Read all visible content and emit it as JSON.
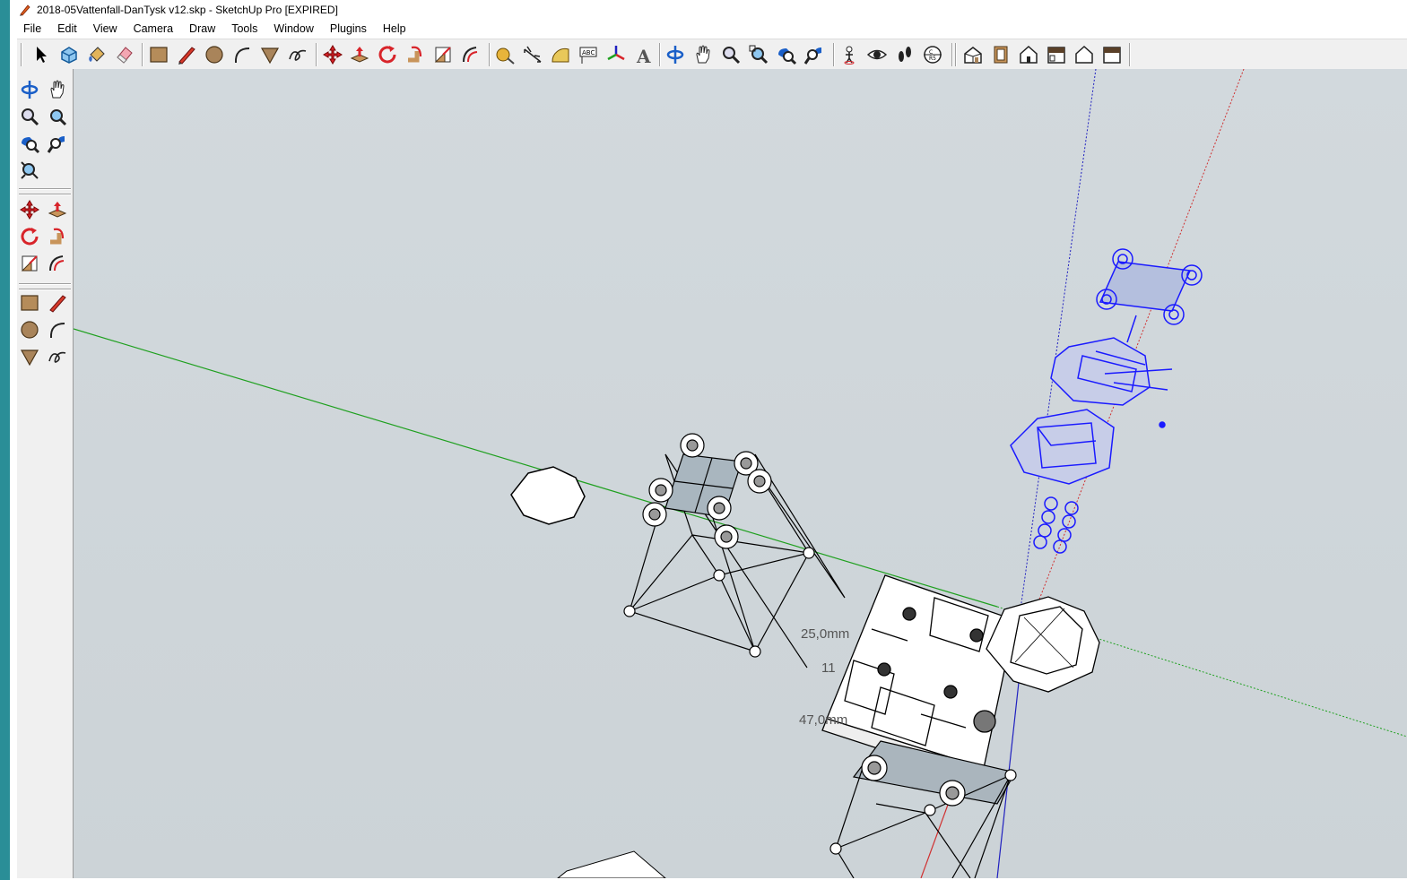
{
  "window": {
    "title": "2018-05Vattenfall-DanTysk v12.skp - SketchUp Pro [EXPIRED]"
  },
  "menu": [
    "File",
    "Edit",
    "View",
    "Camera",
    "Draw",
    "Tools",
    "Window",
    "Plugins",
    "Help"
  ],
  "top_toolbar": {
    "tools": [
      "select-icon",
      "make-component-icon",
      "paint-bucket-icon",
      "eraser-icon",
      "rectangle-icon",
      "line-icon",
      "circle-icon",
      "arc-icon",
      "polygon-icon",
      "freehand-icon",
      "move-icon",
      "push-pull-icon",
      "rotate-icon",
      "follow-me-icon",
      "scale-icon",
      "offset-icon",
      "tape-measure-icon",
      "dimension-icon",
      "protractor-icon",
      "text-icon",
      "axes-icon",
      "3d-text-icon",
      "orbit-icon",
      "pan-icon",
      "zoom-icon",
      "zoom-window-icon",
      "zoom-extents-icon",
      "previous-view-icon",
      "position-camera-icon",
      "look-around-icon",
      "walk-icon",
      "section-plane-icon",
      "iso-view-icon",
      "top-view-icon",
      "front-view-icon",
      "right-view-icon",
      "back-view-icon",
      "left-view-icon"
    ]
  },
  "left_toolbar": {
    "tools": [
      "orbit-icon",
      "pan-icon",
      "zoom-icon",
      "zoom-window-icon",
      "zoom-extents-icon",
      "previous-view-icon",
      "zoom-to-fit-icon",
      "move-icon",
      "push-pull-icon",
      "rotate-icon",
      "follow-me-icon",
      "scale-icon",
      "offset-icon",
      "rectangle-icon",
      "line-icon",
      "circle-icon",
      "arc-icon",
      "polygon-icon",
      "freehand-icon"
    ]
  },
  "viewport": {
    "dimension_labels": [
      "25,0mm",
      "11",
      "47,0mm"
    ],
    "colors": {
      "background": "#cfd6da",
      "selection": "#1a1aff",
      "green_axis": "#1fa01f",
      "red_axis": "#d03030",
      "blue_axis": "#2020c0"
    }
  }
}
